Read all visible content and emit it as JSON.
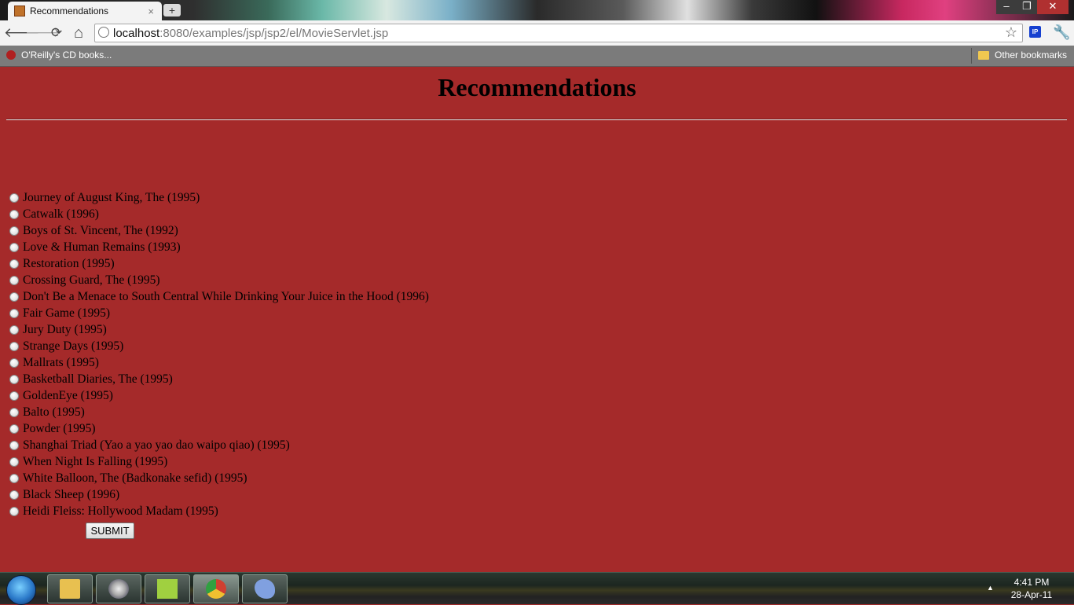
{
  "browser": {
    "tab_title": "Recommendations",
    "tab_close": "×",
    "new_tab": "+",
    "window_controls": {
      "minimize": "–",
      "restore": "❐",
      "close": "✕"
    },
    "nav": {
      "back": "🡐",
      "forward": "🡒",
      "reload": "⟳",
      "home": "⌂"
    },
    "url_host": "localhost",
    "url_rest": ":8080/examples/jsp/jsp2/el/MovieServlet.jsp",
    "star": "☆",
    "ip_badge": "IP",
    "wrench": "🔧",
    "bookmarks": [
      {
        "label": "O'Reilly's CD books..."
      },
      {
        "label": "Other bookmarks"
      }
    ]
  },
  "page": {
    "heading": "Recommendations",
    "movies": [
      "Journey of August King, The (1995)",
      "Catwalk (1996)",
      "Boys of St. Vincent, The (1992)",
      "Love & Human Remains (1993)",
      "Restoration (1995)",
      "Crossing Guard, The (1995)",
      "Don't Be a Menace to South Central While Drinking Your Juice in the Hood (1996)",
      "Fair Game (1995)",
      "Jury Duty (1995)",
      "Strange Days (1995)",
      "Mallrats (1995)",
      "Basketball Diaries, The (1995)",
      "GoldenEye (1995)",
      "Balto (1995)",
      "Powder (1995)",
      "Shanghai Triad (Yao a yao yao dao waipo qiao) (1995)",
      "When Night Is Falling (1995)",
      "White Balloon, The (Badkonake sefid) (1995)",
      "Black Sheep (1996)",
      "Heidi Fleiss: Hollywood Madam (1995)"
    ],
    "submit_label": "SUBMIT"
  },
  "taskbar": {
    "tray_arrow": "▲",
    "time": "4:41 PM",
    "date": "28-Apr-11",
    "apps": [
      {
        "name": "folder-icon",
        "color": "#e8c050"
      },
      {
        "name": "settings-icon",
        "color": "#c0c0c0"
      },
      {
        "name": "notepad-icon",
        "color": "#a0d040"
      },
      {
        "name": "chrome-icon",
        "color": "#d04030"
      },
      {
        "name": "paint-icon",
        "color": "#80a0e0"
      }
    ]
  },
  "colors": {
    "page_background": "#a52a2a",
    "text": "#000000"
  }
}
